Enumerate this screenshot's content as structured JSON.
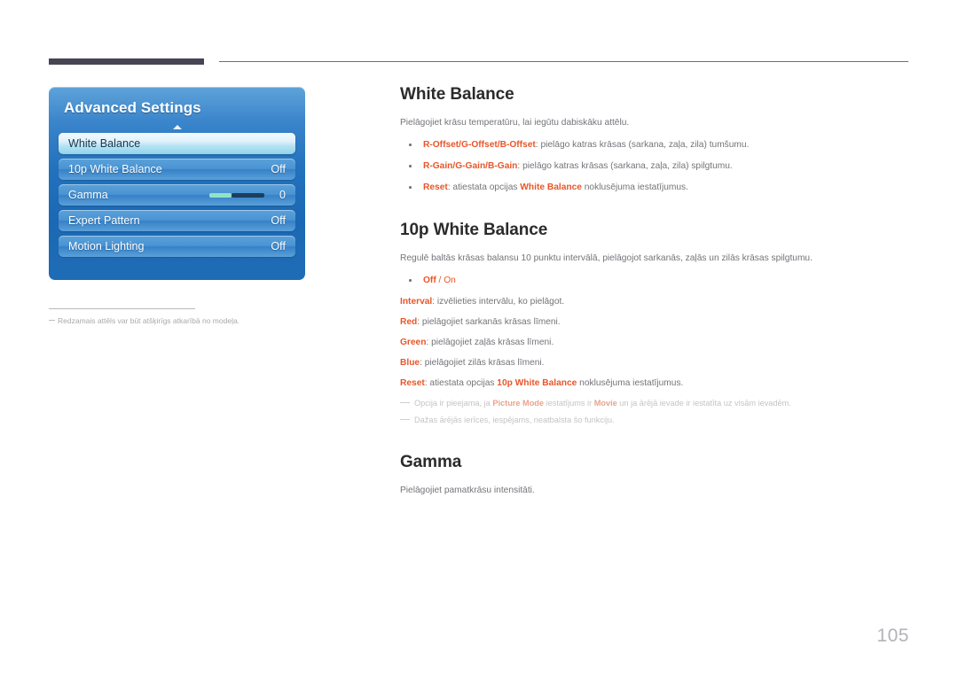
{
  "page": {
    "number": "105"
  },
  "osd": {
    "title": "Advanced Settings",
    "scroll_up_icon": "triangle-up-icon",
    "rows": [
      {
        "label": "White Balance",
        "value": "",
        "type": "selected"
      },
      {
        "label": "10p White Balance",
        "value": "Off",
        "type": "normal"
      },
      {
        "label": "Gamma",
        "value": "0",
        "type": "slider",
        "fill_percent": 40
      },
      {
        "label": "Expert Pattern",
        "value": "Off",
        "type": "normal"
      },
      {
        "label": "Motion Lighting",
        "value": "Off",
        "type": "normal"
      }
    ],
    "footnote": "Redzamais attēls var būt atšķirīgs atkarībā no modeļa."
  },
  "doc": {
    "sections": [
      {
        "heading": "White Balance",
        "description": "Pielāgojiet krāsu temperatūru, lai iegūtu dabiskāku attēlu.",
        "bullets": [
          {
            "key": "R-Offset/G-Offset/B-Offset",
            "rest": ": pielāgo katras krāsas (sarkana, zaļa, zila) tumšumu."
          },
          {
            "key": "R-Gain/G-Gain/B-Gain",
            "rest": ": pielāgo katras krāsas (sarkana, zaļa, zila) spilgtumu."
          },
          {
            "key": "Reset",
            "rest_before": ": atiestata opcijas ",
            "inner_key": "White Balance",
            "rest_after": " noklusējuma iestatījumus."
          }
        ]
      },
      {
        "heading": "10p White Balance",
        "description": "Regulē baltās krāsas balansu 10 punktu intervālā, pielāgojot sarkanās, zaļās un zilās krāsas spilgtumu.",
        "option_bullet": {
          "off": "Off",
          "sep": " / ",
          "on": "On"
        },
        "lines": [
          {
            "key": "Interval",
            "rest": ": izvēlieties intervālu, ko pielāgot."
          },
          {
            "key": "Red",
            "rest": ": pielāgojiet sarkanās krāsas līmeni."
          },
          {
            "key": "Green",
            "rest": ": pielāgojiet zaļās krāsas līmeni."
          },
          {
            "key": "Blue",
            "rest": ": pielāgojiet zilās krāsas līmeni."
          },
          {
            "key": "Reset",
            "rest_before": ": atiestata opcijas ",
            "inner_key": "10p White Balance",
            "rest_after": " noklusējuma iestatījumus."
          }
        ],
        "notes": [
          {
            "a": "Opcija ir pieejama, ja ",
            "k1": "Picture Mode",
            "b": " iestatījums ir ",
            "k2": "Movie",
            "c": " un ja ārējā ievade ir iestatīta uz visām ievadēm."
          },
          {
            "a": "Dažas ārējās ierīces, iespējams, neatbalsta šo funkciju."
          }
        ]
      },
      {
        "heading": "Gamma",
        "description": "Pielāgojiet pamatkrāsu intensitāti."
      }
    ]
  }
}
